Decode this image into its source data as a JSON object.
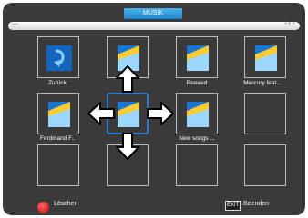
{
  "title": "MUSIK",
  "path": {
    "left": "—",
    "right": "− / −"
  },
  "cells": [
    {
      "caption": "Zurück",
      "icon": "back-arrow-icon"
    },
    {
      "caption": "",
      "icon": "music-file-icon"
    },
    {
      "caption": "Reeeed",
      "icon": "music-file-icon"
    },
    {
      "caption": "Mercury feat...",
      "icon": "music-file-icon"
    },
    {
      "caption": "Ferdinand F..",
      "icon": "music-file-icon"
    },
    {
      "caption": "",
      "icon": "music-file-icon"
    },
    {
      "caption": "New songs ...",
      "icon": "music-file-icon"
    },
    {
      "caption": "",
      "icon": ""
    },
    {
      "caption": "",
      "icon": ""
    },
    {
      "caption": "",
      "icon": ""
    },
    {
      "caption": "",
      "icon": ""
    },
    {
      "caption": "",
      "icon": ""
    }
  ],
  "footer": {
    "delete_label": "Löschen",
    "exit_key": "EXIT",
    "exit_label": "Beenden"
  }
}
